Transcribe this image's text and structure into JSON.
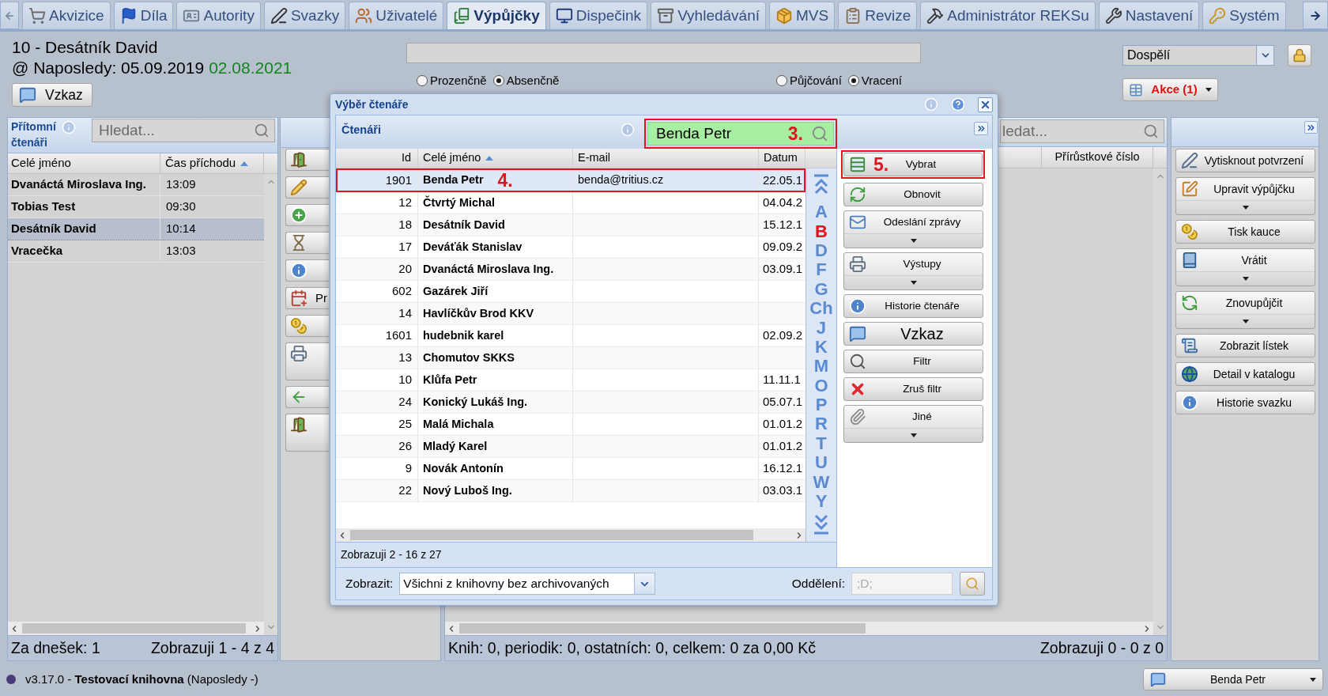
{
  "tabs": [
    {
      "label": "Akvizice",
      "selected": false
    },
    {
      "label": "Díla",
      "selected": false
    },
    {
      "label": "Autority",
      "selected": false
    },
    {
      "label": "Svazky",
      "selected": false
    },
    {
      "label": "Uživatelé",
      "selected": false
    },
    {
      "label": "Výpůjčky",
      "selected": true
    },
    {
      "label": "Dispečink",
      "selected": false
    },
    {
      "label": "Vyhledávání",
      "selected": false
    },
    {
      "label": "MVS",
      "selected": false
    },
    {
      "label": "Revize",
      "selected": false
    },
    {
      "label": "Administrátor REKSu",
      "selected": false
    },
    {
      "label": "Nastavení",
      "selected": false
    },
    {
      "label": "Systém",
      "selected": false
    }
  ],
  "reader": {
    "title": "10 - Desátník David",
    "last_visit": "@ Naposledy: 05.09.2019",
    "current_visit": "02.08.2021",
    "message_button": "Vzkaz"
  },
  "loan_type_options": [
    {
      "label": "Prozenčně",
      "selected": false
    },
    {
      "label": "Absenčně",
      "selected": true
    }
  ],
  "mode_options": [
    {
      "label": "Půjčování",
      "selected": false
    },
    {
      "label": "Vracení",
      "selected": true
    }
  ],
  "category_select": {
    "value": "Dospělí"
  },
  "actions_button": {
    "label": "Akce (1)"
  },
  "present_readers": {
    "title": "Přítomní čtenáři",
    "search": {
      "placeholder": "Hledat..."
    },
    "columns": [
      {
        "label": "Celé jméno",
        "sorted": false
      },
      {
        "label": "Čas příchodu",
        "sorted": true
      }
    ],
    "rows": [
      {
        "name": "Dvanáctá Miroslava Ing.",
        "time": "13:09",
        "selected": false
      },
      {
        "name": "Tobias Test",
        "time": "09:30",
        "selected": false
      },
      {
        "name": "Desátník David",
        "time": "10:14",
        "selected": true
      },
      {
        "name": "Vracečka",
        "time": "13:03",
        "selected": false
      }
    ],
    "today_count": "Za dnešek: 1",
    "paging": "Zobrazuji 1 - 4 z 4"
  },
  "loan_toolbar": [
    {
      "kind": "short"
    },
    {
      "kind": "short"
    },
    {
      "kind": "short"
    },
    {
      "kind": "short"
    },
    {
      "kind": "short"
    },
    {
      "kind": "short",
      "label": "Pr"
    },
    {
      "kind": "short"
    },
    {
      "kind": "tall"
    },
    {
      "kind": "short"
    },
    {
      "kind": "tall"
    }
  ],
  "loans": {
    "search": {
      "placeholder": "ledat..."
    },
    "columns": [
      {
        "label": "Přírůstkové číslo"
      }
    ],
    "summary": "Knih: 0, periodik: 0, ostatních: 0, celkem: 0 za 0,00 Kč",
    "paging": "Zobrazuji 0 - 0 z 0"
  },
  "loan_actions": [
    {
      "label": "Vytisknout potvrzení",
      "kind": "plain"
    },
    {
      "label": "Upravit výpůjčku",
      "kind": "menu"
    },
    {
      "label": "Tisk kauce",
      "kind": "plain"
    },
    {
      "label": "Vrátit",
      "kind": "menu"
    },
    {
      "label": "Znovupůjčit",
      "kind": "menu"
    },
    {
      "label": "Zobrazit lístek",
      "kind": "plain"
    },
    {
      "label": "Detail v katalogu",
      "kind": "plain"
    },
    {
      "label": "Historie svazku",
      "kind": "plain"
    }
  ],
  "dialog": {
    "title": "Výběr čtenáře",
    "panel_title": "Čtenáři",
    "search": {
      "value": "Benda Petr",
      "annotation": "3."
    },
    "columns": [
      {
        "label": "Id",
        "sorted": false
      },
      {
        "label": "Celé jméno",
        "sorted": true
      },
      {
        "label": "E-mail",
        "sorted": false
      },
      {
        "label": "Datum",
        "sorted": false
      }
    ],
    "rows": [
      {
        "id": "1901",
        "name": "Benda Petr",
        "email": "benda@tritius.cz",
        "date": "22.05.1",
        "selected": true,
        "annotation": "4."
      },
      {
        "id": "12",
        "name": "Čtvrtý Michal",
        "date": "04.04.2",
        "selected": false
      },
      {
        "id": "18",
        "name": "Desátník David",
        "date": "15.12.1",
        "selected": false
      },
      {
        "id": "17",
        "name": "Deváťák Stanislav",
        "date": "09.09.2",
        "selected": false
      },
      {
        "id": "20",
        "name": "Dvanáctá Miroslava Ing.",
        "date": "03.09.1",
        "selected": false
      },
      {
        "id": "602",
        "name": "Gazárek Jiří",
        "selected": false
      },
      {
        "id": "14",
        "name": "Havlíčkův Brod KKV",
        "selected": false
      },
      {
        "id": "1601",
        "name": "hudebnik karel",
        "date": "02.09.2",
        "selected": false
      },
      {
        "id": "13",
        "name": "Chomutov SKKS",
        "selected": false
      },
      {
        "id": "10",
        "name": "Klůfa Petr",
        "date": "11.11.1",
        "selected": false
      },
      {
        "id": "24",
        "name": "Konický Lukáš Ing.",
        "date": "05.07.1",
        "selected": false
      },
      {
        "id": "25",
        "name": "Malá Michala",
        "date": "01.01.2",
        "selected": false
      },
      {
        "id": "26",
        "name": "Mladý Karel",
        "date": "01.01.2",
        "selected": false
      },
      {
        "id": "9",
        "name": "Novák Antonín",
        "date": "16.12.1",
        "selected": false
      },
      {
        "id": "22",
        "name": "Nový Luboš Ing.",
        "date": "03.03.1",
        "selected": false
      }
    ],
    "letters": [
      {
        "label": "A",
        "selected": false
      },
      {
        "label": "B",
        "selected": true
      },
      {
        "label": "D",
        "selected": false
      },
      {
        "label": "F",
        "selected": false
      },
      {
        "label": "G",
        "selected": false
      },
      {
        "label": "Ch",
        "selected": false
      },
      {
        "label": "J",
        "selected": false
      },
      {
        "label": "K",
        "selected": false
      },
      {
        "label": "M",
        "selected": false
      },
      {
        "label": "O",
        "selected": false
      },
      {
        "label": "P",
        "selected": false
      },
      {
        "label": "R",
        "selected": false
      },
      {
        "label": "T",
        "selected": false
      },
      {
        "label": "U",
        "selected": false
      },
      {
        "label": "W",
        "selected": false
      },
      {
        "label": "Y",
        "selected": false
      }
    ],
    "paging": "Zobrazuji 2 - 16 z 27",
    "filter_label": "Zobrazit:",
    "filter_select": {
      "value": "Všichni z knihovny bez archivovaných"
    },
    "department_label": "Oddělení:",
    "department_field": {
      "placeholder": ";D;"
    },
    "buttons": [
      {
        "label": "Vybrat",
        "kind": "plain",
        "annotation": "5."
      },
      {
        "label": "Obnovit",
        "kind": "plain"
      },
      {
        "label": "Odeslání zprávy",
        "kind": "menu"
      },
      {
        "label": "Výstupy",
        "kind": "menu"
      },
      {
        "label": "Historie čtenáře",
        "kind": "plain"
      },
      {
        "label": "Vzkaz",
        "kind": "large"
      },
      {
        "label": "Filtr",
        "kind": "plain"
      },
      {
        "label": "Zruš filtr",
        "kind": "plain"
      },
      {
        "label": "Jiné",
        "kind": "menu"
      }
    ]
  },
  "status_bar": {
    "text": "v3.17.0 - **Testovací knihovna** (Naposledy -)",
    "user_button": "Benda Petr"
  }
}
